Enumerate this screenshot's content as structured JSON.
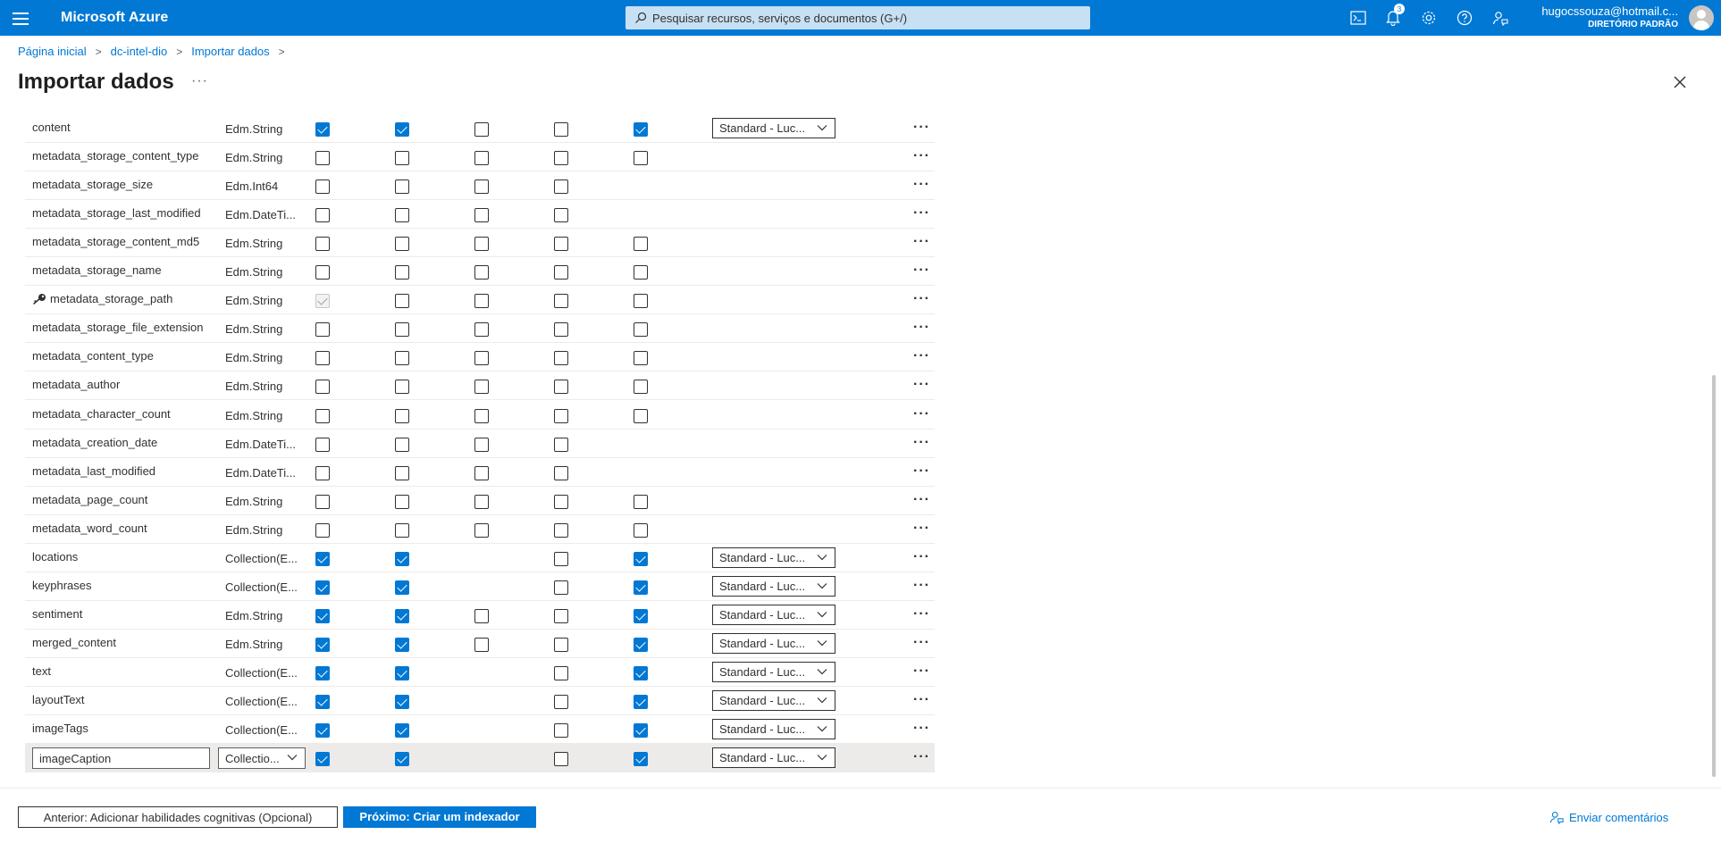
{
  "app": {
    "brand": "Microsoft Azure",
    "search_placeholder": "Pesquisar recursos, serviços e documentos (G+/)",
    "notifications_count": "3",
    "account_email": "hugocssouza@hotmail.c...",
    "account_directory": "DIRETÓRIO PADRÃO",
    "accent_color": "#0078d4"
  },
  "breadcrumb": [
    "Página inicial",
    "dc-intel-dio",
    "Importar dados"
  ],
  "page": {
    "title": "Importar dados",
    "more": "···"
  },
  "table": {
    "rows": [
      {
        "name": "content",
        "type": "Edm.String",
        "checks": [
          1,
          1,
          0,
          0,
          1
        ],
        "analyzer": "Standard - Luc..."
      },
      {
        "name": "metadata_storage_content_type",
        "type": "Edm.String",
        "checks": [
          0,
          0,
          0,
          0,
          0
        ],
        "analyzer": null
      },
      {
        "name": "metadata_storage_size",
        "type": "Edm.Int64",
        "checks": [
          0,
          0,
          0,
          0,
          null
        ],
        "analyzer": null
      },
      {
        "name": "metadata_storage_last_modified",
        "type": "Edm.DateTi...",
        "checks": [
          0,
          0,
          0,
          0,
          null
        ],
        "analyzer": null
      },
      {
        "name": "metadata_storage_content_md5",
        "type": "Edm.String",
        "checks": [
          0,
          0,
          0,
          0,
          0
        ],
        "analyzer": null
      },
      {
        "name": "metadata_storage_name",
        "type": "Edm.String",
        "checks": [
          0,
          0,
          0,
          0,
          0
        ],
        "analyzer": null
      },
      {
        "name": "metadata_storage_path",
        "type": "Edm.String",
        "checks": [
          "d",
          0,
          0,
          0,
          0
        ],
        "analyzer": null,
        "key": true
      },
      {
        "name": "metadata_storage_file_extension",
        "type": "Edm.String",
        "checks": [
          0,
          0,
          0,
          0,
          0
        ],
        "analyzer": null
      },
      {
        "name": "metadata_content_type",
        "type": "Edm.String",
        "checks": [
          0,
          0,
          0,
          0,
          0
        ],
        "analyzer": null
      },
      {
        "name": "metadata_author",
        "type": "Edm.String",
        "checks": [
          0,
          0,
          0,
          0,
          0
        ],
        "analyzer": null
      },
      {
        "name": "metadata_character_count",
        "type": "Edm.String",
        "checks": [
          0,
          0,
          0,
          0,
          0
        ],
        "analyzer": null
      },
      {
        "name": "metadata_creation_date",
        "type": "Edm.DateTi...",
        "checks": [
          0,
          0,
          0,
          0,
          null
        ],
        "analyzer": null
      },
      {
        "name": "metadata_last_modified",
        "type": "Edm.DateTi...",
        "checks": [
          0,
          0,
          0,
          0,
          null
        ],
        "analyzer": null
      },
      {
        "name": "metadata_page_count",
        "type": "Edm.String",
        "checks": [
          0,
          0,
          0,
          0,
          0
        ],
        "analyzer": null
      },
      {
        "name": "metadata_word_count",
        "type": "Edm.String",
        "checks": [
          0,
          0,
          0,
          0,
          0
        ],
        "analyzer": null
      },
      {
        "name": "locations",
        "type": "Collection(E...",
        "checks": [
          1,
          1,
          null,
          0,
          1
        ],
        "analyzer": "Standard - Luc..."
      },
      {
        "name": "keyphrases",
        "type": "Collection(E...",
        "checks": [
          1,
          1,
          null,
          0,
          1
        ],
        "analyzer": "Standard - Luc..."
      },
      {
        "name": "sentiment",
        "type": "Edm.String",
        "checks": [
          1,
          1,
          0,
          0,
          1
        ],
        "analyzer": "Standard - Luc..."
      },
      {
        "name": "merged_content",
        "type": "Edm.String",
        "checks": [
          1,
          1,
          0,
          0,
          1
        ],
        "analyzer": "Standard - Luc..."
      },
      {
        "name": "text",
        "type": "Collection(E...",
        "checks": [
          1,
          1,
          null,
          0,
          1
        ],
        "analyzer": "Standard - Luc..."
      },
      {
        "name": "layoutText",
        "type": "Collection(E...",
        "checks": [
          1,
          1,
          null,
          0,
          1
        ],
        "analyzer": "Standard - Luc..."
      },
      {
        "name": "imageTags",
        "type": "Collection(E...",
        "checks": [
          1,
          1,
          null,
          0,
          1
        ],
        "analyzer": "Standard - Luc..."
      },
      {
        "name": "imageCaption",
        "type": "Collectio...",
        "checks": [
          1,
          1,
          null,
          0,
          1
        ],
        "analyzer": "Standard - Luc...",
        "editing": true
      }
    ]
  },
  "footer": {
    "prev_label": "Anterior: Adicionar habilidades cognitivas (Opcional)",
    "next_label": "Próximo: Criar um indexador",
    "feedback_label": "Enviar comentários"
  }
}
